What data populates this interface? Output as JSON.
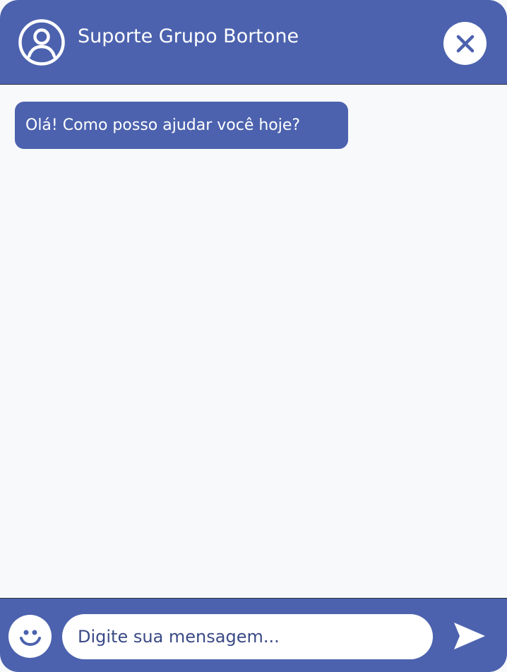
{
  "header": {
    "title": "Suporte Grupo Bortone",
    "avatar_icon": "user-circle-icon",
    "close_icon": "close-icon"
  },
  "messages": [
    {
      "sender": "bot",
      "text": "Olá! Como posso ajudar você hoje?"
    }
  ],
  "composer": {
    "emoji_icon": "smiley-icon",
    "placeholder": "Digite sua mensagem...",
    "value": "",
    "send_icon": "send-icon"
  },
  "colors": {
    "brand": "#4c62ae",
    "background": "#f8f9fb",
    "text_on_brand": "#ffffff",
    "placeholder_text": "#3a4a86"
  }
}
